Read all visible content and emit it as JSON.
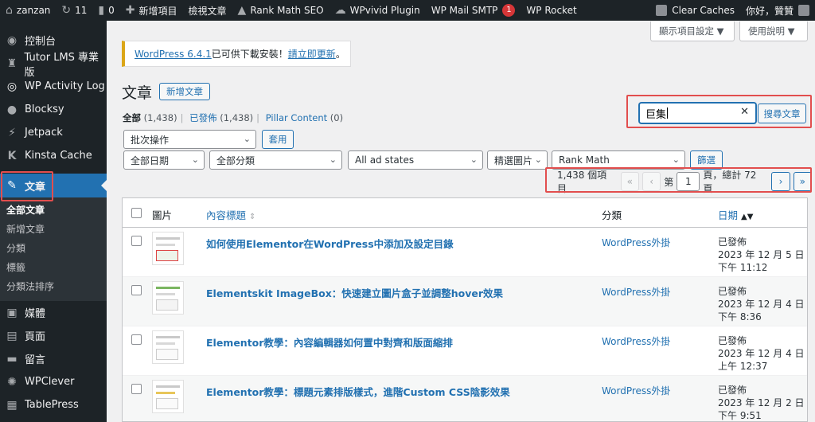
{
  "adminbar": {
    "site": "zanzan",
    "updates": "11",
    "comments": "0",
    "new_item": "新增項目",
    "view_post": "檢視文章",
    "rank_math": "Rank Math SEO",
    "wpvivid": "WPvivid Plugin",
    "wp_mail": "WP Mail SMTP",
    "wp_mail_badge": "1",
    "wp_rocket": "WP Rocket",
    "clear_caches": "Clear Caches",
    "greeting": "你好，贊贊"
  },
  "sidebar": {
    "items": [
      {
        "label": "控制台",
        "icon": "dashboard-icon"
      },
      {
        "label": "Tutor LMS 專業版",
        "icon": "tutor-icon"
      },
      {
        "label": "WP Activity Log",
        "icon": "activity-log-icon"
      },
      {
        "label": "Blocksy",
        "icon": "blocksy-icon"
      },
      {
        "label": "Jetpack",
        "icon": "jetpack-icon"
      },
      {
        "label": "Kinsta Cache",
        "icon": "kinsta-icon"
      },
      {
        "label": "文章",
        "icon": "pin-icon"
      }
    ],
    "submenu": [
      "全部文章",
      "新增文章",
      "分類",
      "標籤",
      "分類法排序"
    ],
    "items_after": [
      {
        "label": "媒體",
        "icon": "media-icon"
      },
      {
        "label": "頁面",
        "icon": "page-icon"
      },
      {
        "label": "留言",
        "icon": "comment-icon"
      },
      {
        "label": "WPClever",
        "icon": "wpclever-icon"
      },
      {
        "label": "TablePress",
        "icon": "tablepress-icon"
      }
    ]
  },
  "screen_options": "顯示項目設定 ▼",
  "help": "使用說明 ▼",
  "notice": {
    "version": "WordPress 6.4.1",
    "text": " 已可供下載安裝！",
    "link": "請立即更新",
    "end": "。"
  },
  "page_title": "文章",
  "add_new": "新增文章",
  "views": {
    "all": "全部",
    "all_count": "(1,438)",
    "published": "已發佈",
    "published_count": "(1,438)",
    "pillar": "Pillar Content",
    "pillar_count": "(0)"
  },
  "bulk": {
    "select": "批次操作",
    "apply": "套用"
  },
  "filters": {
    "dates": "全部日期",
    "categories": "全部分類",
    "ad_states": "All ad states",
    "featured": "精選圖片",
    "rank_math": "Rank Math",
    "filter_btn": "篩選"
  },
  "search": {
    "value": "巨集",
    "button": "搜尋文章"
  },
  "pagination": {
    "items": "1,438 個項目",
    "page_prefix": "第",
    "current": "1",
    "page_suffix": "頁，總計 72 頁"
  },
  "table": {
    "headers": {
      "image": "圖片",
      "title": "內容標題",
      "category": "分類",
      "date": "日期"
    },
    "rows": [
      {
        "title": "如何使用Elementor在WordPress中添加及設定目錄",
        "category": "WordPress外掛",
        "status": "已發佈",
        "date": "2023 年 12 月 5 日",
        "time": "下午 11:12"
      },
      {
        "title": "Elementskit ImageBox：快速建立圖片盒子並調整hover效果",
        "category": "WordPress外掛",
        "status": "已發佈",
        "date": "2023 年 12 月 4 日",
        "time": "下午 8:36"
      },
      {
        "title": "Elementor教學：內容編輯器如何置中對齊和版面縮排",
        "category": "WordPress外掛",
        "status": "已發佈",
        "date": "2023 年 12 月 4 日",
        "time": "上午 12:37"
      },
      {
        "title": "Elementor教學：標題元素排版樣式，進階Custom CSS陰影效果",
        "category": "WordPress外掛",
        "status": "已發佈",
        "date": "2023 年 12 月 2 日",
        "time": "下午 9:51"
      }
    ]
  }
}
